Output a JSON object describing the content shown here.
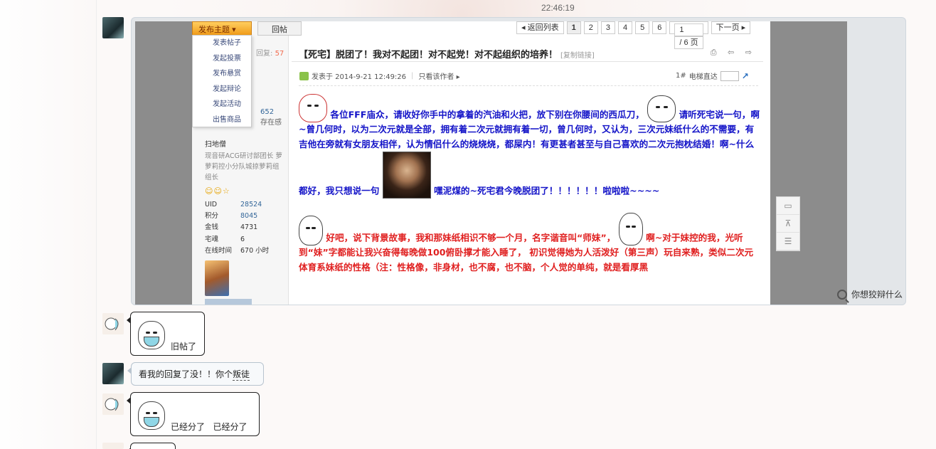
{
  "timestamp": "22:46:19",
  "forum": {
    "publish_label": "发布主题",
    "reply_label": "回帖",
    "dropdown_items": [
      "发表帖子",
      "发起投票",
      "发布悬赏",
      "发起辩论",
      "发起活动",
      "出售商品"
    ],
    "pager": {
      "back": "◂ 返回列表",
      "pages": [
        "1",
        "2",
        "3",
        "4",
        "5",
        "6"
      ],
      "current": "1",
      "input_value": "1",
      "total": "/ 6 页",
      "next": "下一页 ▸"
    },
    "reply_count_label": "回复:",
    "reply_count": "57",
    "stats_value": "652",
    "stats_label": "存在感",
    "username": "扫地僧",
    "user_title": "现音研ACG研讨部团长 萝萝莉控小分队城掠萝莉组组长",
    "user_emos": "☺☺☆",
    "user_info": [
      {
        "key": "UID",
        "value": "28524",
        "link": true
      },
      {
        "key": "积分",
        "value": "8045",
        "link": true
      },
      {
        "key": "金钱",
        "value": "4731",
        "link": false
      },
      {
        "key": "宅魂",
        "value": "6",
        "link": false
      },
      {
        "key": "在线时间",
        "value": "670 小时",
        "link": false
      }
    ],
    "thread_title": "【死宅】脱团了！我对不起团！对不起党！对不起组织的培养！",
    "copy_link": "[复制链接]",
    "tools": "⎙ ⇦ ⇨",
    "posted_at": "发表于 2014-9-21 12:49:26",
    "only_author": "只看该作者 ▸",
    "floor": "1#",
    "floor_jump": "电梯直达",
    "post_p1a": "各位FFF庙众，请收好你手中的拿着的汽油和火把，放下别在你腰间的西瓜刀，",
    "post_p1b": "请听死宅说一句，啊~曾几何时，以为二次元就是全部，拥有着二次元就拥有着一切，曾几何时，又认为，三次元妹纸什么的不需要，有吉他在旁就有女朋友相伴，认为情侣什么的烧烧烧，都屎内！有更甚者甚至与自己喜欢的二次元抱枕结婚！啊~什么都好，我只想说一句",
    "post_p1c": "嘿泥煤的~死宅君今晚脱团了！！！！！！啦啦啦~~~~",
    "post_p2a": "好吧，说下背景故事，我和那妹纸相识不够一个月，名字谐音叫“师妹”，",
    "post_p2b": "啊~对于妹控的我，光听到“妹”字都能让我兴奋得每晚做100俯卧撑才能入睡了， 初识觉得她为人活泼好（第三声）玩自来熟，类似二次元体育系妹纸的性格（注：性格像，非身材，也不腐，也不脑，个人觉的单纯，就是看厚黑"
  },
  "image_caption": "你想狡辩什么",
  "messages": [
    {
      "text": "旧帖了",
      "has_sticker": true
    },
    {
      "text": "看我的回复了没！！你个",
      "underlined": "叛徒"
    },
    {
      "text": "已经分了   已经分了",
      "has_sticker": true
    }
  ],
  "colors": {
    "blue_text": "#1414c8",
    "red_text": "#e02020",
    "publish_button": "#f09c1a"
  }
}
